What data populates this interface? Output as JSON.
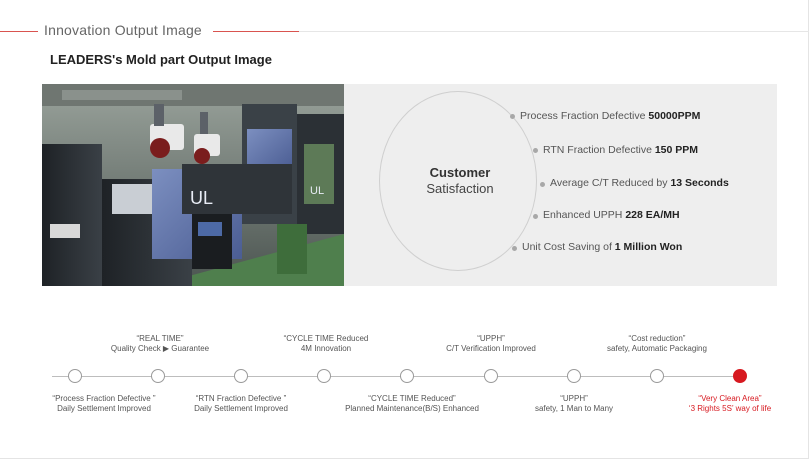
{
  "header": {
    "section_title": "Innovation Output Image",
    "sub_title": "LEADERS's Mold part Output Image"
  },
  "photo": {
    "machine_label_1": "UL",
    "machine_label_2": "UL"
  },
  "panel": {
    "center_line1": "Customer",
    "center_line2": "Satisfaction",
    "items": [
      {
        "prefix": "Process Fraction Defective ",
        "value": "50000PPM",
        "suffix": ""
      },
      {
        "prefix": "RTN Fraction Defective ",
        "value": "150 PPM",
        "suffix": ""
      },
      {
        "prefix": "Average C/T Reduced by ",
        "value": "13 Seconds",
        "suffix": ""
      },
      {
        "prefix": "Enhanced UPPH ",
        "value": "228 EA/MH",
        "suffix": ""
      },
      {
        "prefix": "Unit Cost Saving of ",
        "value": "1 Million Won",
        "suffix": ""
      }
    ]
  },
  "timeline": {
    "top_labels": [
      {
        "line1": "“REAL TIME”",
        "line2": "Quality Check ▶ Guarantee"
      },
      {
        "line1": "“CYCLE TIME Reduced",
        "line2": "4M Innovation"
      },
      {
        "line1": "“UPPH”",
        "line2": "C/T Verification Improved"
      },
      {
        "line1": "“Cost reduction”",
        "line2": "safety, Automatic Packaging"
      }
    ],
    "bottom_labels": [
      {
        "line1": "“Process Fraction Defective ”",
        "line2": "Daily Settlement Improved"
      },
      {
        "line1": "“RTN Fraction Defective ”",
        "line2": "Daily Settlement Improved"
      },
      {
        "line1": "“CYCLE TIME Reduced”",
        "line2": "Planned Maintenance(B/S)  Enhanced"
      },
      {
        "line1": "“UPPH”",
        "line2": "safety, 1 Man to Many"
      },
      {
        "line1": "“Very Clean Area”",
        "line2": "‘3 Rights 5S’ way of life"
      }
    ]
  },
  "colors": {
    "accent": "#d71920",
    "panel_bg": "#eeeeee",
    "header_line": "#d9534f"
  }
}
